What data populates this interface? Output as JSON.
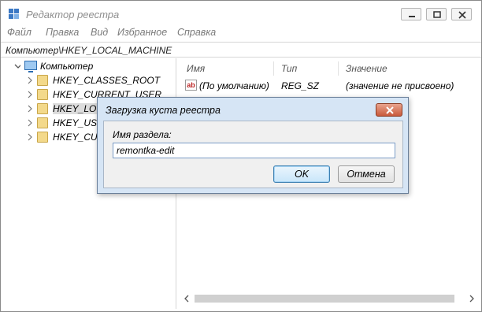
{
  "window": {
    "title": "Редактор реестра",
    "colors": {
      "accent": "#3b78c4",
      "folder": "#f3d98b",
      "dialog_frame": "#d6e5f5",
      "close_button": "#c95a3c"
    }
  },
  "menu": [
    "Файл",
    "Правка",
    "Вид",
    "Избранное",
    "Справка"
  ],
  "address": "Компьютер\\HKEY_LOCAL_MACHINE",
  "tree": {
    "root": "Компьютер",
    "items": [
      {
        "label": "HKEY_CLASSES_ROOT"
      },
      {
        "label": "HKEY_CURRENT_USER"
      },
      {
        "label": "HKEY_LOC",
        "selected": true
      },
      {
        "label": "HKEY_USEI"
      },
      {
        "label": "HKEY_CUR"
      }
    ]
  },
  "values_pane": {
    "columns": [
      "Имя",
      "Тип",
      "Значение"
    ],
    "rows": [
      {
        "icon": "string-value-icon",
        "icon_text": "ab",
        "name": "(По умолчанию)",
        "type": "REG_SZ",
        "value": "(значение не присвоено)"
      }
    ]
  },
  "dialog": {
    "title": "Загрузка куста реестра",
    "field_label": "Имя раздела:",
    "field_value": "remontka-edit",
    "ok_label": "OK",
    "cancel_label": "Отмена"
  }
}
